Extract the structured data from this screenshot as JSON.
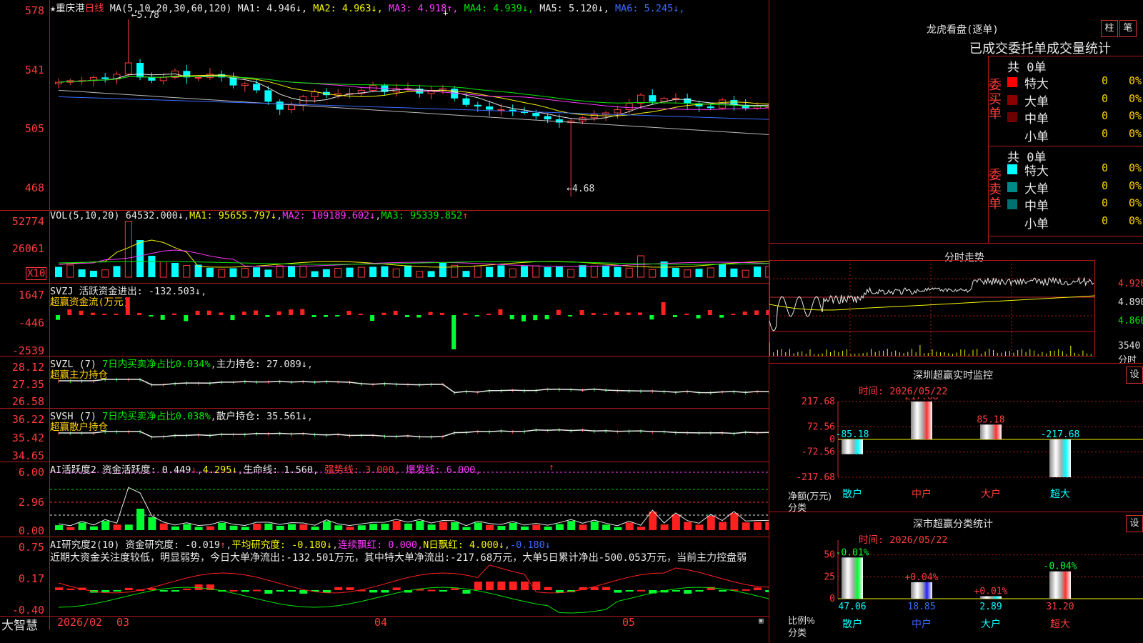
{
  "main": {
    "stock_name": "重庆港",
    "period": "日线",
    "ma_label": "MA(5,10,20,30,60,120)",
    "ma_values": [
      {
        "label": "MA1:",
        "value": "4.946",
        "arrow": "↓",
        "color": "#e8e8e8"
      },
      {
        "label": "MA2:",
        "value": "4.963",
        "arrow": "↓",
        "color": "#f5f500"
      },
      {
        "label": "MA3:",
        "value": "4.918",
        "arrow": "↑",
        "color": "#ff38ff"
      },
      {
        "label": "MA4:",
        "value": "4.939",
        "arrow": "↓",
        "color": "#00e600"
      },
      {
        "label": "MA5:",
        "value": "5.120",
        "arrow": "↓",
        "color": "#e8e8e8"
      },
      {
        "label": "MA6:",
        "value": "5.245",
        "arrow": "↓",
        "color": "#3b6bff"
      }
    ],
    "high_marker": "5.78",
    "low_marker": "4.68",
    "y_ticks": [
      "578",
      "541",
      "505",
      "468"
    ]
  },
  "vol": {
    "header": "VOL(5,10,20)",
    "value": "64532.000",
    "ma1": "MA1: 95655.797",
    "ma2": "MA2: 109189.602",
    "ma3": "MA3: 95339.852",
    "y_ticks": [
      "52774",
      "26061"
    ],
    "unit": "X10"
  },
  "svzj": {
    "header": "SVZJ  活跃资金进出: -132.503",
    "subtitle": "超赢资金流(万元)",
    "y_ticks": [
      "1647",
      "-446",
      "-2539"
    ]
  },
  "svzl": {
    "header_a": "SVZL (7)",
    "header_b": "7日内买卖净占比0.034%",
    "header_c": "主力持仓: 27.089",
    "subtitle": "超赢主力持仓",
    "y_ticks": [
      "28.12",
      "27.35",
      "26.58"
    ]
  },
  "svsh": {
    "header_a": "SVSH (7)",
    "header_b": "7日内买卖净占比0.038%",
    "header_c": "散户持仓: 35.561",
    "subtitle": "超赢散户持仓",
    "y_ticks": [
      "36.22",
      "35.42",
      "34.65"
    ]
  },
  "ai1": {
    "header_a": "AI活跃度2 资金活跃度: 0.449",
    "header_b": "4.295",
    "header_c": "生命线: 1.560,",
    "header_d": "强势线: 3.000,",
    "header_e": "爆发线: 6.000,",
    "y_ticks": [
      "6.00",
      "2.96",
      "0.00"
    ]
  },
  "ai2": {
    "header_a": "AI研究度2(10) 资金研究度: -0.019",
    "header_b": "平均研究度: -0.180",
    "header_c": "连续飘红: 0.000,",
    "header_d": "N日飘红: 4.000",
    "header_e": "-0.180",
    "summary": "近期大资金关注度较低，明显弱势，今日大单净流出:-132.501万元，其中特大单净流出:-217.68万元，大单5日累计净出-500.053万元，当前主力控盘弱",
    "y_ticks": [
      "0.75",
      "0.17",
      "-0.40"
    ]
  },
  "xaxis": {
    "brand": "大智慧",
    "labels": [
      "2026/02",
      "03",
      "04",
      "05"
    ]
  },
  "right": {
    "lhkp_title": "龙虎看盘(逐单)",
    "btn_zhu": "柱",
    "btn_bi": "笔",
    "stats_header": "已成交委托单成交量统计",
    "buy_label": "委买单",
    "sell_label": "委卖单",
    "buy_total": "共 0单",
    "sell_total": "共 0单",
    "buy_rows": [
      {
        "name": "特大",
        "v1": "0",
        "v2": "0%",
        "color": "#ff0000"
      },
      {
        "name": "大单",
        "v1": "0",
        "v2": "0%",
        "color": "#8b0000"
      },
      {
        "name": "中单",
        "v1": "0",
        "v2": "0%",
        "color": "#6a0000"
      },
      {
        "name": "小单",
        "v1": "0",
        "v2": "0%",
        "color": "#000000"
      }
    ],
    "sell_rows": [
      {
        "name": "特大",
        "v1": "0",
        "v2": "0%",
        "color": "#00ffff"
      },
      {
        "name": "大单",
        "v1": "0",
        "v2": "0%",
        "color": "#008b8b"
      },
      {
        "name": "中单",
        "v1": "0",
        "v2": "0%",
        "color": "#007070"
      },
      {
        "name": "小单",
        "v1": "0",
        "v2": "0%",
        "color": "#000000"
      }
    ],
    "fenshi_title": "分时走势",
    "fenshi_prices": [
      "4.920",
      "4.890",
      "4.860"
    ],
    "fenshi_vol": "3540",
    "fenshi_vol_unit": "分时",
    "monitor_title": "深圳超赢实时监控",
    "monitor_time": "时间: 2026/05/22",
    "monitor_set": "设",
    "monitor_yaxis_label": "净额(万元)",
    "monitor_xaxis_label": "分类",
    "classify_title": "深市超赢分类统计",
    "classify_time": "时间: 2026/05/22",
    "classify_set": "设",
    "classify_yaxis_label": "比例%",
    "classify_xaxis_label": "分类"
  },
  "chart_data": [
    {
      "type": "bar",
      "title": "深圳超赢实时监控",
      "ylabel": "净额(万元)",
      "xlabel": "分类",
      "categories": [
        "散户",
        "中户",
        "大户",
        "超大"
      ],
      "values": [
        -85.18,
        217.68,
        85.18,
        -217.68
      ],
      "value_labels": [
        "-85.18",
        "217.68",
        "85.18",
        "-217.68"
      ],
      "y_ticks": [
        "217.68",
        "72.56",
        "0",
        "-72.56",
        "-217.68"
      ],
      "ylim": [
        -217.68,
        217.68
      ]
    },
    {
      "type": "bar",
      "title": "深市超赢分类统计",
      "ylabel": "比例%",
      "xlabel": "分类",
      "categories": [
        "散户",
        "中户",
        "大户",
        "超大"
      ],
      "values": [
        47.06,
        18.85,
        2.89,
        31.2
      ],
      "value_labels": [
        "47.06",
        "18.85",
        "2.89",
        "31.20"
      ],
      "change_labels": [
        "-0.01%",
        "+0.04%",
        "+0.01%",
        "-0.04%"
      ],
      "y_ticks": [
        "75",
        "50",
        "25",
        "0"
      ],
      "ylim": [
        0,
        75
      ]
    }
  ]
}
